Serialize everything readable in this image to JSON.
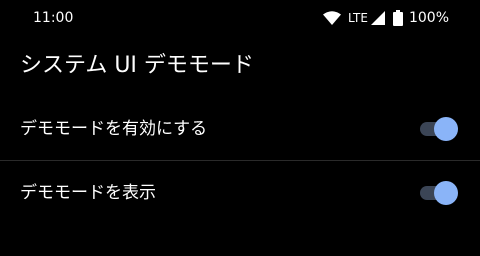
{
  "status_bar": {
    "time": "11:00",
    "network": "LTE",
    "battery": "100%",
    "icons": [
      "wifi-icon",
      "cell-signal-icon",
      "battery-icon"
    ]
  },
  "page": {
    "title": "システム UI デモモード"
  },
  "settings": [
    {
      "label": "デモモードを有効にする",
      "enabled": true
    },
    {
      "label": "デモモードを表示",
      "enabled": true
    }
  ],
  "colors": {
    "background": "#000000",
    "text": "#ffffff",
    "switch_thumb_on": "#8ab4f8",
    "switch_track_on": "#3b4556",
    "divider": "#2a2a2a"
  }
}
